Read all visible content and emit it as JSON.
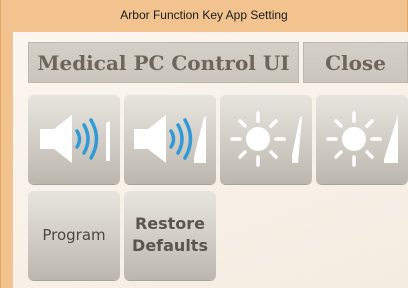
{
  "window": {
    "title": "Arbor Function Key  App Setting"
  },
  "header": {
    "title": "Medical PC Control UI",
    "close_label": "Close"
  },
  "tiles": [
    {
      "icon": "volume-down-icon"
    },
    {
      "icon": "volume-up-icon"
    },
    {
      "icon": "brightness-down-icon"
    },
    {
      "icon": "brightness-up-icon"
    }
  ],
  "actions": {
    "program_label": "Program",
    "restore_line1": "Restore",
    "restore_line2": "Defaults"
  },
  "colors": {
    "frame": "#f2c38e",
    "client": "#f8f3eb",
    "tile": "#d3cfc8",
    "accent_blue": "#2f9ad6"
  }
}
